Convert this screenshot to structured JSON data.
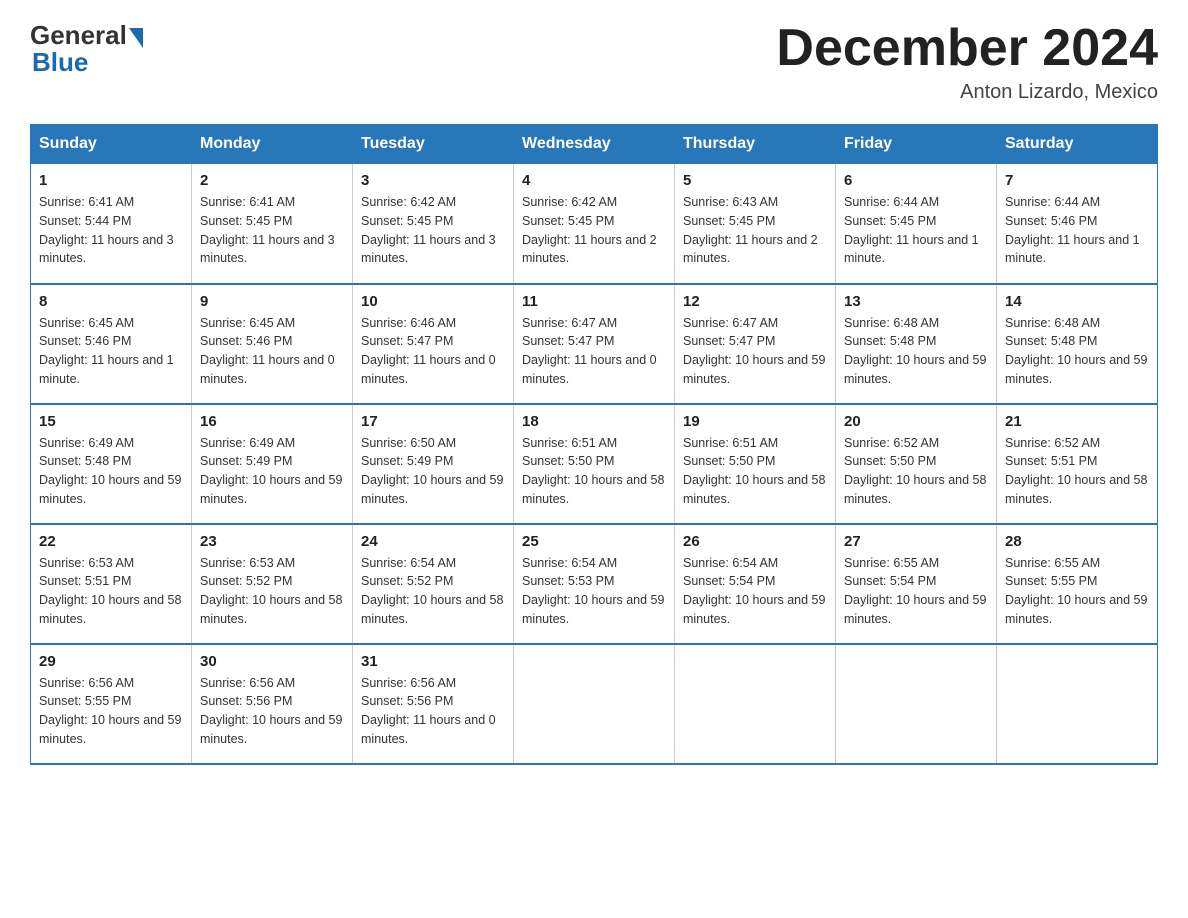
{
  "header": {
    "logo_general": "General",
    "logo_blue": "Blue",
    "month_title": "December 2024",
    "location": "Anton Lizardo, Mexico"
  },
  "weekdays": [
    "Sunday",
    "Monday",
    "Tuesday",
    "Wednesday",
    "Thursday",
    "Friday",
    "Saturday"
  ],
  "weeks": [
    [
      {
        "day": "1",
        "sunrise": "6:41 AM",
        "sunset": "5:44 PM",
        "daylight": "11 hours and 3 minutes."
      },
      {
        "day": "2",
        "sunrise": "6:41 AM",
        "sunset": "5:45 PM",
        "daylight": "11 hours and 3 minutes."
      },
      {
        "day": "3",
        "sunrise": "6:42 AM",
        "sunset": "5:45 PM",
        "daylight": "11 hours and 3 minutes."
      },
      {
        "day": "4",
        "sunrise": "6:42 AM",
        "sunset": "5:45 PM",
        "daylight": "11 hours and 2 minutes."
      },
      {
        "day": "5",
        "sunrise": "6:43 AM",
        "sunset": "5:45 PM",
        "daylight": "11 hours and 2 minutes."
      },
      {
        "day": "6",
        "sunrise": "6:44 AM",
        "sunset": "5:45 PM",
        "daylight": "11 hours and 1 minute."
      },
      {
        "day": "7",
        "sunrise": "6:44 AM",
        "sunset": "5:46 PM",
        "daylight": "11 hours and 1 minute."
      }
    ],
    [
      {
        "day": "8",
        "sunrise": "6:45 AM",
        "sunset": "5:46 PM",
        "daylight": "11 hours and 1 minute."
      },
      {
        "day": "9",
        "sunrise": "6:45 AM",
        "sunset": "5:46 PM",
        "daylight": "11 hours and 0 minutes."
      },
      {
        "day": "10",
        "sunrise": "6:46 AM",
        "sunset": "5:47 PM",
        "daylight": "11 hours and 0 minutes."
      },
      {
        "day": "11",
        "sunrise": "6:47 AM",
        "sunset": "5:47 PM",
        "daylight": "11 hours and 0 minutes."
      },
      {
        "day": "12",
        "sunrise": "6:47 AM",
        "sunset": "5:47 PM",
        "daylight": "10 hours and 59 minutes."
      },
      {
        "day": "13",
        "sunrise": "6:48 AM",
        "sunset": "5:48 PM",
        "daylight": "10 hours and 59 minutes."
      },
      {
        "day": "14",
        "sunrise": "6:48 AM",
        "sunset": "5:48 PM",
        "daylight": "10 hours and 59 minutes."
      }
    ],
    [
      {
        "day": "15",
        "sunrise": "6:49 AM",
        "sunset": "5:48 PM",
        "daylight": "10 hours and 59 minutes."
      },
      {
        "day": "16",
        "sunrise": "6:49 AM",
        "sunset": "5:49 PM",
        "daylight": "10 hours and 59 minutes."
      },
      {
        "day": "17",
        "sunrise": "6:50 AM",
        "sunset": "5:49 PM",
        "daylight": "10 hours and 59 minutes."
      },
      {
        "day": "18",
        "sunrise": "6:51 AM",
        "sunset": "5:50 PM",
        "daylight": "10 hours and 58 minutes."
      },
      {
        "day": "19",
        "sunrise": "6:51 AM",
        "sunset": "5:50 PM",
        "daylight": "10 hours and 58 minutes."
      },
      {
        "day": "20",
        "sunrise": "6:52 AM",
        "sunset": "5:50 PM",
        "daylight": "10 hours and 58 minutes."
      },
      {
        "day": "21",
        "sunrise": "6:52 AM",
        "sunset": "5:51 PM",
        "daylight": "10 hours and 58 minutes."
      }
    ],
    [
      {
        "day": "22",
        "sunrise": "6:53 AM",
        "sunset": "5:51 PM",
        "daylight": "10 hours and 58 minutes."
      },
      {
        "day": "23",
        "sunrise": "6:53 AM",
        "sunset": "5:52 PM",
        "daylight": "10 hours and 58 minutes."
      },
      {
        "day": "24",
        "sunrise": "6:54 AM",
        "sunset": "5:52 PM",
        "daylight": "10 hours and 58 minutes."
      },
      {
        "day": "25",
        "sunrise": "6:54 AM",
        "sunset": "5:53 PM",
        "daylight": "10 hours and 59 minutes."
      },
      {
        "day": "26",
        "sunrise": "6:54 AM",
        "sunset": "5:54 PM",
        "daylight": "10 hours and 59 minutes."
      },
      {
        "day": "27",
        "sunrise": "6:55 AM",
        "sunset": "5:54 PM",
        "daylight": "10 hours and 59 minutes."
      },
      {
        "day": "28",
        "sunrise": "6:55 AM",
        "sunset": "5:55 PM",
        "daylight": "10 hours and 59 minutes."
      }
    ],
    [
      {
        "day": "29",
        "sunrise": "6:56 AM",
        "sunset": "5:55 PM",
        "daylight": "10 hours and 59 minutes."
      },
      {
        "day": "30",
        "sunrise": "6:56 AM",
        "sunset": "5:56 PM",
        "daylight": "10 hours and 59 minutes."
      },
      {
        "day": "31",
        "sunrise": "6:56 AM",
        "sunset": "5:56 PM",
        "daylight": "11 hours and 0 minutes."
      },
      null,
      null,
      null,
      null
    ]
  ],
  "labels": {
    "sunrise": "Sunrise:",
    "sunset": "Sunset:",
    "daylight": "Daylight:"
  }
}
